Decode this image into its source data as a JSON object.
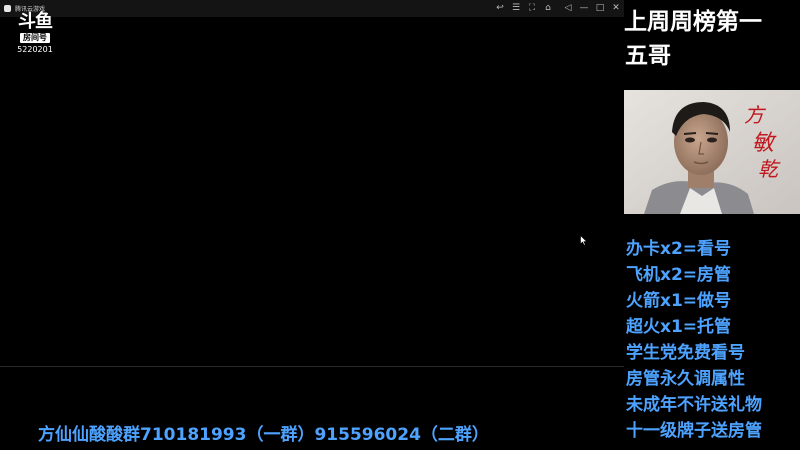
{
  "window": {
    "title": "腾讯云游戏",
    "controls": [
      "↩",
      "☰",
      "⛶",
      "⌂",
      "◁",
      "—",
      "□",
      "✕"
    ]
  },
  "watermark": {
    "logo": "斗鱼",
    "badge": "房间号",
    "room_id": "5220201"
  },
  "panel": {
    "title": "上周周榜第一",
    "subtitle": "五哥",
    "signature": "方敏乾",
    "rules": [
      "办卡x2=看号",
      "飞机x2=房管",
      "火箭x1=做号",
      "超火x1=托管",
      "学生党免费看号",
      "房管永久调属性",
      "未成年不许送礼物",
      "十一级牌子送房管"
    ]
  },
  "banner": {
    "text": "方仙仙酸酸群710181993（一群）915596024（二群）"
  },
  "colors": {
    "accent_text": "#4da3ff",
    "background": "#000000",
    "titlebar": "#141414"
  }
}
